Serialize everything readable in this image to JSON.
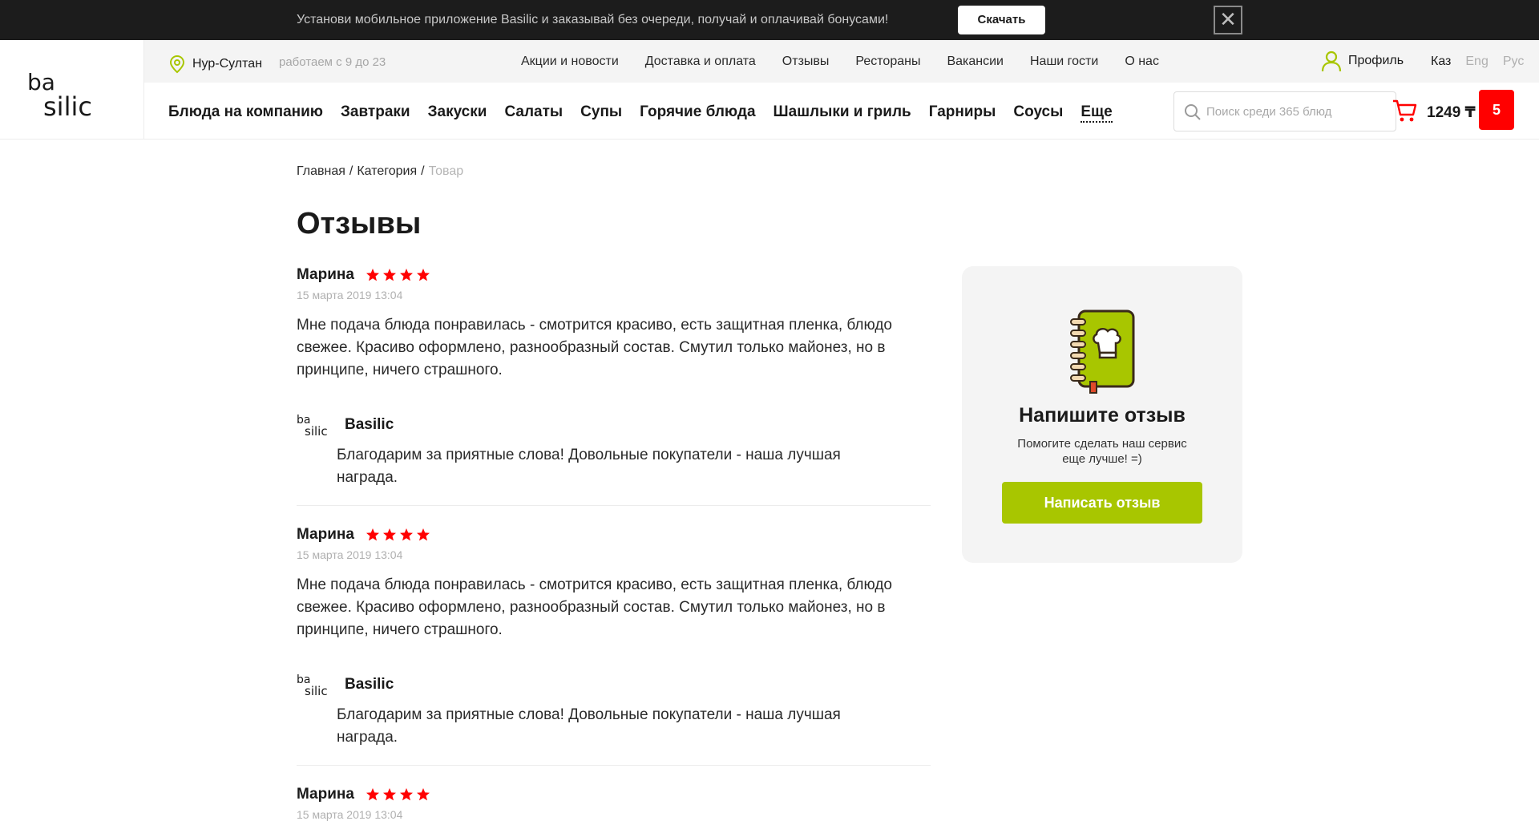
{
  "promo": {
    "text": "Установи мобильное приложение Basilic и заказывай без очереди, получай и оплачивай бонусами!",
    "button": "Скачать",
    "close_icon": "close-icon"
  },
  "logo": {
    "line1": "ba",
    "line2": "silic"
  },
  "topbar": {
    "city": "Нур-Султан",
    "hours": "работаем с 9 до 23",
    "nav": [
      "Акции и новости",
      "Доставка и оплата",
      "Отзывы",
      "Рестораны",
      "Вакансии",
      "Наши гости",
      "О нас"
    ],
    "profile": "Профиль",
    "langs": [
      "Каз",
      "Eng",
      "Рус"
    ],
    "active_lang": "Каз"
  },
  "categories": [
    "Блюда на компанию",
    "Завтраки",
    "Закуски",
    "Салаты",
    "Супы",
    "Горячие блюда",
    "Шашлыки и гриль",
    "Гарниры",
    "Соусы"
  ],
  "more_label": "Еще",
  "search": {
    "placeholder": "Поиск среди 365 блюд"
  },
  "cart": {
    "total": "1249 ₸",
    "count": "5"
  },
  "breadcrumb": {
    "home": "Главная",
    "category": "Категория",
    "current": "Товар"
  },
  "page_title": "Отзывы",
  "reviews": [
    {
      "author": "Марина",
      "rating": 4,
      "date": "15 марта 2019 13:04",
      "text": "Мне подача блюда понравилась - смотрится красиво, есть защитная пленка, блюдо свежее. Красиво оформлено, разнообразный состав. Смутил только майонез, но в принципе, ничего страшного.",
      "reply_name": "Basilic",
      "reply_text": "Благодарим за приятные слова! Довольные покупатели - наша лучшая награда."
    },
    {
      "author": "Марина",
      "rating": 4,
      "date": "15 марта 2019 13:04",
      "text": "Мне подача блюда понравилась - смотрится красиво, есть защитная пленка, блюдо свежее. Красиво оформлено, разнообразный состав. Смутил только майонез, но в принципе, ничего страшного.",
      "reply_name": "Basilic",
      "reply_text": "Благодарим за приятные слова! Довольные покупатели - наша лучшая награда."
    },
    {
      "author": "Марина",
      "rating": 4,
      "date": "15 марта 2019 13:04"
    }
  ],
  "side": {
    "title": "Напишите отзыв",
    "subtitle": "Помогите сделать наш сервис еще лучше! =)",
    "button": "Написать отзыв"
  },
  "colors": {
    "accent_green": "#a8c600",
    "star_red": "#ff0000",
    "dark_banner": "#1c1c1c"
  }
}
